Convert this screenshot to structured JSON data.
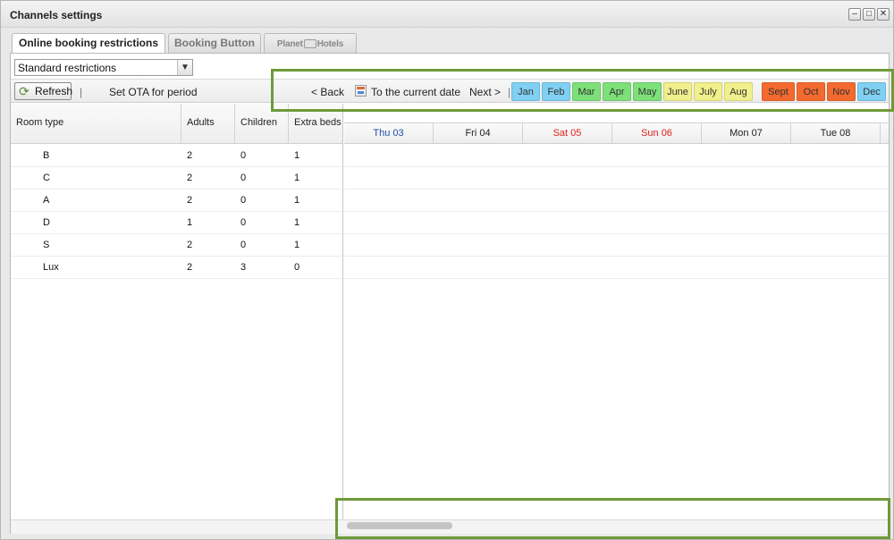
{
  "window": {
    "title": "Channels settings"
  },
  "tabs": [
    {
      "label": "Online booking restrictions"
    },
    {
      "label": "Booking Button"
    },
    {
      "label": "Planet Hotels"
    }
  ],
  "restriction_select": {
    "value": "Standard restrictions"
  },
  "toolbar": {
    "refresh": "Refresh",
    "separator": "|",
    "set_ota": "Set OTA for period",
    "back": "< Back",
    "current_date": "To the current date",
    "next": "Next >"
  },
  "months": [
    {
      "label": "Jan",
      "color": "#7fd0f2"
    },
    {
      "label": "Feb",
      "color": "#7fd0f2"
    },
    {
      "label": "Mar",
      "color": "#7de07a"
    },
    {
      "label": "Apr",
      "color": "#7de07a"
    },
    {
      "label": "May",
      "color": "#7de07a"
    },
    {
      "label": "June",
      "color": "#f0f08c"
    },
    {
      "label": "July",
      "color": "#f0f08c"
    },
    {
      "label": "Aug",
      "color": "#f0f08c"
    },
    {
      "label": "Sept",
      "color": "#f46a2e"
    },
    {
      "label": "Oct",
      "color": "#f46a2e"
    },
    {
      "label": "Nov",
      "color": "#f46a2e"
    },
    {
      "label": "Dec",
      "color": "#7fd0f2"
    }
  ],
  "columns": {
    "room_type": "Room type",
    "adults": "Adults",
    "children": "Children",
    "extra_beds": "Extra beds"
  },
  "rooms": [
    {
      "type": "B",
      "adults": "2",
      "children": "0",
      "extra": "1"
    },
    {
      "type": "C",
      "adults": "2",
      "children": "0",
      "extra": "1"
    },
    {
      "type": "A",
      "adults": "2",
      "children": "0",
      "extra": "1"
    },
    {
      "type": "D",
      "adults": "1",
      "children": "0",
      "extra": "1"
    },
    {
      "type": "S",
      "adults": "2",
      "children": "0",
      "extra": "1"
    },
    {
      "type": "Lux",
      "adults": "2",
      "children": "3",
      "extra": "0"
    }
  ],
  "days": [
    {
      "label": "Thu 03",
      "color": "#1d4fa8"
    },
    {
      "label": "Fri 04",
      "color": "#222222"
    },
    {
      "label": "Sat 05",
      "color": "#e0201a"
    },
    {
      "label": "Sun 06",
      "color": "#e0201a"
    },
    {
      "label": "Mon 07",
      "color": "#222222"
    },
    {
      "label": "Tue 08",
      "color": "#222222"
    }
  ],
  "highlight_color": "#6e9a3a"
}
